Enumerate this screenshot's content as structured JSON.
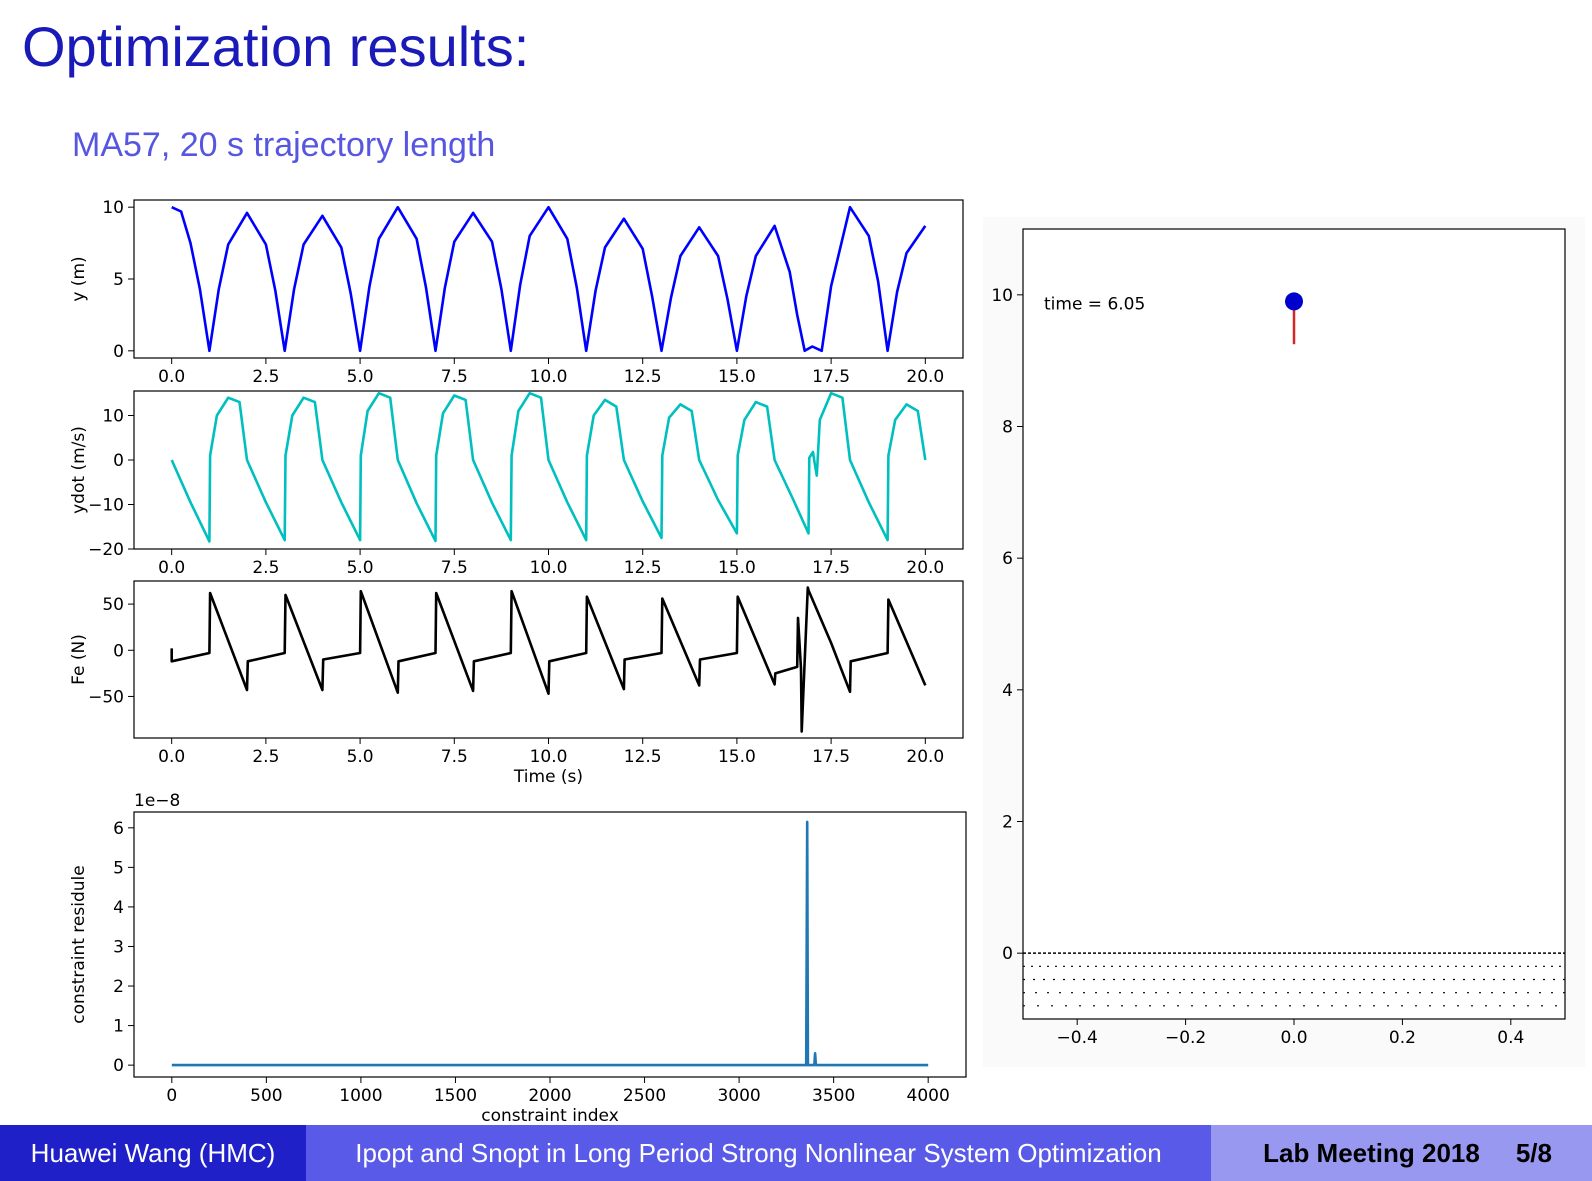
{
  "slide": {
    "title": "Optimization results:",
    "subtitle": "MA57, 20 s trajectory length"
  },
  "footer": {
    "author": "Huawei Wang (HMC)",
    "talk_title": "Ipopt and Snopt in Long Period Strong Nonlinear System Optimization",
    "event": "Lab Meeting 2018",
    "page": "5/8"
  },
  "colors": {
    "blue_line": "#0000ff",
    "cyan_line": "#00bfbf",
    "black_line": "#000000",
    "residue_line": "#1f77b4",
    "pole_red": "#d62728",
    "ball_blue": "#0000cc"
  },
  "chart_data": [
    {
      "type": "line",
      "id": "y",
      "ylabel": "y (m)",
      "xlabel": "",
      "xlim": [
        -1,
        21
      ],
      "ylim": [
        -0.5,
        10.5
      ],
      "xticks": [
        "0.0",
        "2.5",
        "5.0",
        "7.5",
        "10.0",
        "12.5",
        "15.0",
        "17.5",
        "20.0"
      ],
      "yticks": [
        "0",
        "5",
        "10"
      ],
      "series": [
        {
          "color": "blue_line",
          "x": [
            0,
            0.25,
            0.5,
            0.75,
            1,
            1.25,
            1.5,
            2,
            2.5,
            2.75,
            3,
            3.25,
            3.5,
            4,
            4.5,
            4.75,
            5,
            5.25,
            5.5,
            6,
            6.5,
            6.75,
            7,
            7.25,
            7.5,
            8,
            8.5,
            8.75,
            9,
            9.25,
            9.5,
            10,
            10.5,
            10.75,
            11,
            11.25,
            11.5,
            12,
            12.5,
            12.75,
            13,
            13.25,
            13.5,
            14,
            14.5,
            14.75,
            15,
            15.25,
            15.5,
            16,
            16.4,
            16.6,
            16.8,
            17,
            17.25,
            17.5,
            18,
            18.5,
            18.75,
            19,
            19.25,
            19.5,
            20
          ],
          "y": [
            10,
            9.7,
            7.5,
            4.3,
            0,
            4.3,
            7.4,
            9.6,
            7.4,
            4.2,
            0,
            4.3,
            7.4,
            9.4,
            7.2,
            4.0,
            0,
            4.5,
            7.8,
            10,
            7.8,
            4.4,
            0,
            4.4,
            7.6,
            9.6,
            7.6,
            4.3,
            0,
            4.6,
            8.0,
            10,
            7.8,
            4.4,
            0,
            4.2,
            7.2,
            9.2,
            7.1,
            3.8,
            0,
            3.7,
            6.6,
            8.6,
            6.6,
            3.6,
            0,
            3.8,
            6.6,
            8.7,
            5.5,
            2.5,
            0,
            0.3,
            0,
            4.5,
            10,
            8,
            4.8,
            0,
            4.1,
            6.8,
            8.7
          ]
        }
      ]
    },
    {
      "type": "line",
      "id": "ydot",
      "ylabel": "ydot (m/s)",
      "xlabel": "",
      "xlim": [
        -1,
        21
      ],
      "ylim": [
        -20,
        15.5
      ],
      "xticks": [
        "0.0",
        "2.5",
        "5.0",
        "7.5",
        "10.0",
        "12.5",
        "15.0",
        "17.5",
        "20.0"
      ],
      "yticks": [
        "−20",
        "−10",
        "0",
        "10"
      ],
      "series": [
        {
          "color": "cyan_line",
          "x": [
            0,
            0.5,
            1,
            1.02,
            1.2,
            1.5,
            1.8,
            2.0,
            2.5,
            3,
            3.02,
            3.2,
            3.5,
            3.8,
            4.0,
            4.5,
            5,
            5.02,
            5.2,
            5.5,
            5.8,
            6.0,
            6.5,
            7,
            7.02,
            7.2,
            7.5,
            7.8,
            8.0,
            8.5,
            9,
            9.02,
            9.2,
            9.5,
            9.8,
            10,
            10.5,
            11,
            11.02,
            11.2,
            11.5,
            11.8,
            12,
            12.5,
            13,
            13.02,
            13.2,
            13.5,
            13.8,
            14,
            14.5,
            15,
            15.02,
            15.2,
            15.5,
            15.8,
            16,
            16.5,
            16.9,
            16.92,
            17.02,
            17.06,
            17.12,
            17.2,
            17.5,
            17.8,
            18,
            18.5,
            19,
            19.02,
            19.2,
            19.5,
            19.8,
            20
          ],
          "y": [
            0,
            -9.5,
            -18.3,
            1,
            10,
            14,
            13,
            0,
            -9.5,
            -18,
            1,
            10,
            14,
            13,
            0,
            -9.5,
            -18,
            1,
            11,
            15,
            14,
            0,
            -9.7,
            -18.2,
            1,
            10.5,
            14.5,
            13.5,
            0,
            -9.6,
            -18,
            1,
            11,
            15,
            14,
            0,
            -9.5,
            -18,
            1,
            10,
            13.5,
            12,
            0,
            -9.3,
            -17.5,
            1,
            9.5,
            12.5,
            11,
            0,
            -9,
            -16.5,
            1,
            9,
            13,
            12,
            0,
            -9,
            -16.5,
            0.5,
            1.8,
            -0.5,
            -3.5,
            9,
            15,
            14,
            0,
            -9.5,
            -18,
            1,
            9,
            12.5,
            11,
            0
          ]
        }
      ]
    },
    {
      "type": "line",
      "id": "fe",
      "ylabel": "Fe (N)",
      "xlabel": "Time (s)",
      "xlim": [
        -1,
        21
      ],
      "ylim": [
        -95,
        75
      ],
      "xticks": [
        "0.0",
        "2.5",
        "5.0",
        "7.5",
        "10.0",
        "12.5",
        "15.0",
        "17.5",
        "20.0"
      ],
      "yticks": [
        "−50",
        "0",
        "50"
      ],
      "series": [
        {
          "color": "black_line",
          "x": [
            0,
            0,
            1,
            1.02,
            2,
            2.02,
            3,
            3.02,
            4,
            4.02,
            5,
            5.02,
            6,
            6.02,
            7,
            7.02,
            8,
            8.02,
            9,
            9.02,
            10,
            10.02,
            11,
            11.02,
            12,
            12.02,
            13,
            13.02,
            14,
            14.02,
            15,
            15.02,
            16,
            16.02,
            16.6,
            16.62,
            16.7,
            16.72,
            16.88,
            16.9,
            17.5,
            18,
            18.02,
            19,
            19.02,
            20
          ],
          "y": [
            2,
            -12,
            -3,
            62,
            -43,
            -12,
            -3,
            60,
            -43,
            -10,
            -3,
            64,
            -46,
            -12,
            -3,
            62,
            -44,
            -12,
            -3,
            64,
            -47,
            -12,
            -3,
            58,
            -42,
            -10,
            -3,
            56,
            -38,
            -10,
            -3,
            58,
            -37,
            -25,
            -18,
            35,
            -20,
            -88,
            68,
            65,
            8,
            -45,
            -12,
            -3,
            55,
            -38
          ]
        }
      ]
    },
    {
      "type": "line",
      "id": "residue",
      "ylabel": "constraint residule",
      "xlabel": "constraint index",
      "multiplier_label": "1e−8",
      "xlim": [
        -200,
        4200
      ],
      "ylim": [
        -0.3,
        6.4
      ],
      "xticks": [
        "0",
        "500",
        "1000",
        "1500",
        "2000",
        "2500",
        "3000",
        "3500",
        "4000"
      ],
      "yticks": [
        "0",
        "1",
        "2",
        "3",
        "4",
        "5",
        "6"
      ],
      "series": [
        {
          "color": "residue_line",
          "x": [
            0,
            3355,
            3360,
            3364,
            3368,
            3398,
            3402,
            3406,
            4000
          ],
          "y": [
            0,
            0,
            6.15,
            0,
            0,
            0,
            0.3,
            0,
            0
          ]
        }
      ]
    },
    {
      "type": "scatter",
      "id": "animation",
      "annotation": "time = 6.05",
      "xlim": [
        -0.5,
        0.5
      ],
      "ylim": [
        -1,
        11
      ],
      "xticks": [
        "−0.4",
        "−0.2",
        "0.0",
        "0.2",
        "0.4"
      ],
      "yticks": [
        "0",
        "2",
        "4",
        "6",
        "8",
        "10"
      ],
      "ball": {
        "x": 0.0,
        "y": 9.9
      },
      "pole": {
        "x": 0.0,
        "y_top": 9.9,
        "y_bottom": 9.25
      },
      "ground_levels": [
        0,
        -0.2,
        -0.4,
        -0.6,
        -0.8
      ]
    }
  ]
}
